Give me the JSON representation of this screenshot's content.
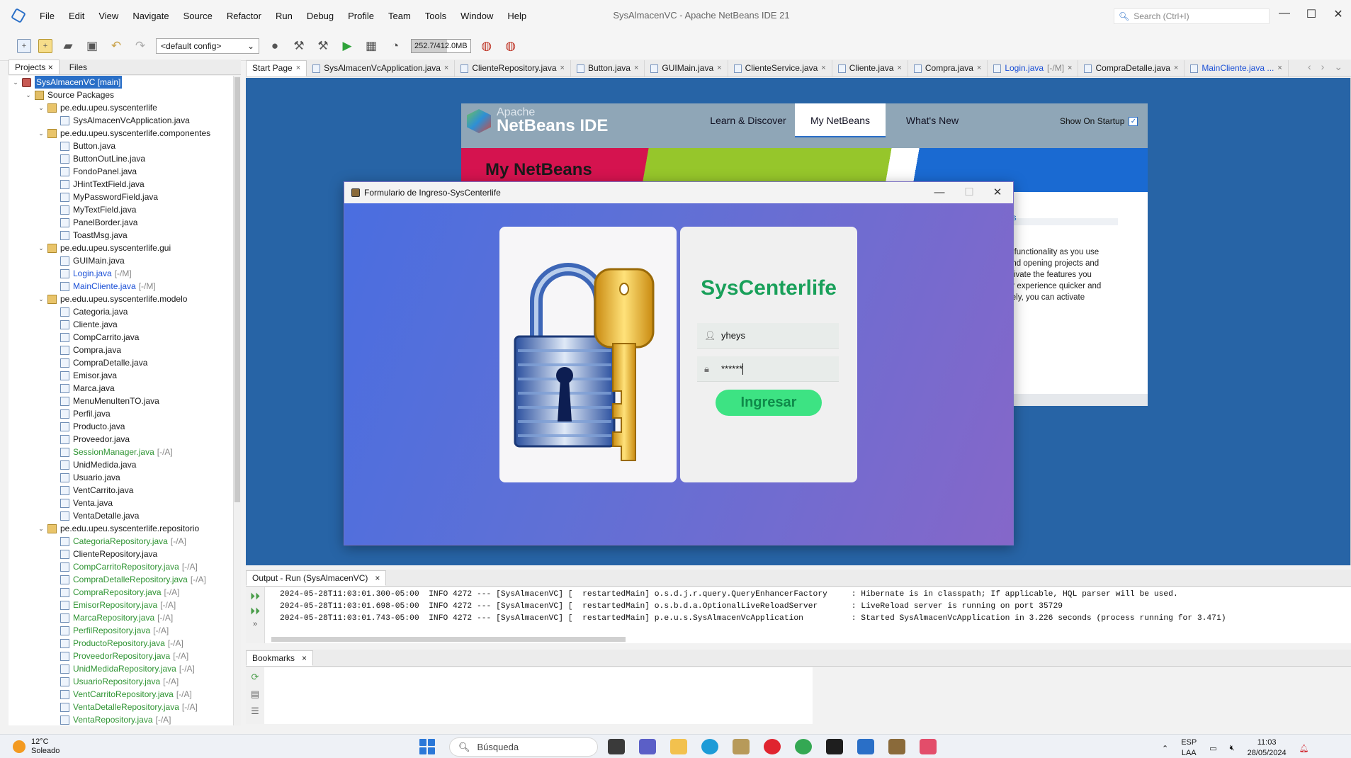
{
  "window": {
    "title": "SysAlmacenVC - Apache NetBeans IDE 21",
    "search_placeholder": "Search (Ctrl+I)",
    "minimize": "—",
    "maximize": "☐",
    "close": "✕"
  },
  "menu": [
    "File",
    "Edit",
    "View",
    "Navigate",
    "Source",
    "Refactor",
    "Run",
    "Debug",
    "Profile",
    "Team",
    "Tools",
    "Window",
    "Help"
  ],
  "toolbar": {
    "config": "<default config>",
    "memory": "252.7/412.0MB"
  },
  "left_panel": {
    "tabs": [
      {
        "label": "Projects",
        "close": "×"
      },
      {
        "label": "Files"
      }
    ],
    "tree": [
      {
        "label": "SysAlmacenVC [main]",
        "depth": 0,
        "type": "proj",
        "toggle": "⌄",
        "selected": true
      },
      {
        "label": "Source Packages",
        "depth": 1,
        "type": "src",
        "toggle": "⌄"
      },
      {
        "label": "pe.edu.upeu.syscenterlife",
        "depth": 2,
        "type": "pkg",
        "toggle": "⌄"
      },
      {
        "label": "SysAlmacenVcApplication.java",
        "depth": 3,
        "type": "file"
      },
      {
        "label": "pe.edu.upeu.syscenterlife.componentes",
        "depth": 2,
        "type": "pkg",
        "toggle": "⌄"
      },
      {
        "label": "Button.java",
        "depth": 3,
        "type": "file"
      },
      {
        "label": "ButtonOutLine.java",
        "depth": 3,
        "type": "file"
      },
      {
        "label": "FondoPanel.java",
        "depth": 3,
        "type": "file"
      },
      {
        "label": "JHintTextField.java",
        "depth": 3,
        "type": "file"
      },
      {
        "label": "MyPasswordField.java",
        "depth": 3,
        "type": "file"
      },
      {
        "label": "MyTextField.java",
        "depth": 3,
        "type": "file"
      },
      {
        "label": "PanelBorder.java",
        "depth": 3,
        "type": "file"
      },
      {
        "label": "ToastMsg.java",
        "depth": 3,
        "type": "file"
      },
      {
        "label": "pe.edu.upeu.syscenterlife.gui",
        "depth": 2,
        "type": "pkg",
        "toggle": "⌄"
      },
      {
        "label": "GUIMain.java",
        "depth": 3,
        "type": "file"
      },
      {
        "label": "Login.java",
        "depth": 3,
        "type": "file",
        "status": "[-/M]",
        "state": "mod"
      },
      {
        "label": "MainCliente.java",
        "depth": 3,
        "type": "file",
        "status": "[-/M]",
        "state": "mod"
      },
      {
        "label": "pe.edu.upeu.syscenterlife.modelo",
        "depth": 2,
        "type": "pkg",
        "toggle": "⌄"
      },
      {
        "label": "Categoria.java",
        "depth": 3,
        "type": "file"
      },
      {
        "label": "Cliente.java",
        "depth": 3,
        "type": "file"
      },
      {
        "label": "CompCarrito.java",
        "depth": 3,
        "type": "file"
      },
      {
        "label": "Compra.java",
        "depth": 3,
        "type": "file"
      },
      {
        "label": "CompraDetalle.java",
        "depth": 3,
        "type": "file"
      },
      {
        "label": "Emisor.java",
        "depth": 3,
        "type": "file"
      },
      {
        "label": "Marca.java",
        "depth": 3,
        "type": "file"
      },
      {
        "label": "MenuMenuItenTO.java",
        "depth": 3,
        "type": "file"
      },
      {
        "label": "Perfil.java",
        "depth": 3,
        "type": "file"
      },
      {
        "label": "Producto.java",
        "depth": 3,
        "type": "file"
      },
      {
        "label": "Proveedor.java",
        "depth": 3,
        "type": "file"
      },
      {
        "label": "SessionManager.java",
        "depth": 3,
        "type": "file",
        "status": "[-/A]",
        "state": "add"
      },
      {
        "label": "UnidMedida.java",
        "depth": 3,
        "type": "file"
      },
      {
        "label": "Usuario.java",
        "depth": 3,
        "type": "file"
      },
      {
        "label": "VentCarrito.java",
        "depth": 3,
        "type": "file"
      },
      {
        "label": "Venta.java",
        "depth": 3,
        "type": "file"
      },
      {
        "label": "VentaDetalle.java",
        "depth": 3,
        "type": "file"
      },
      {
        "label": "pe.edu.upeu.syscenterlife.repositorio",
        "depth": 2,
        "type": "pkg",
        "toggle": "⌄"
      },
      {
        "label": "CategoriaRepository.java",
        "depth": 3,
        "type": "file",
        "status": "[-/A]",
        "state": "add"
      },
      {
        "label": "ClienteRepository.java",
        "depth": 3,
        "type": "file"
      },
      {
        "label": "CompCarritoRepository.java",
        "depth": 3,
        "type": "file",
        "status": "[-/A]",
        "state": "add"
      },
      {
        "label": "CompraDetalleRepository.java",
        "depth": 3,
        "type": "file",
        "status": "[-/A]",
        "state": "add"
      },
      {
        "label": "CompraRepository.java",
        "depth": 3,
        "type": "file",
        "status": "[-/A]",
        "state": "add"
      },
      {
        "label": "EmisorRepository.java",
        "depth": 3,
        "type": "file",
        "status": "[-/A]",
        "state": "add"
      },
      {
        "label": "MarcaRepository.java",
        "depth": 3,
        "type": "file",
        "status": "[-/A]",
        "state": "add"
      },
      {
        "label": "PerfilRepository.java",
        "depth": 3,
        "type": "file",
        "status": "[-/A]",
        "state": "add"
      },
      {
        "label": "ProductoRepository.java",
        "depth": 3,
        "type": "file",
        "status": "[-/A]",
        "state": "add"
      },
      {
        "label": "ProveedorRepository.java",
        "depth": 3,
        "type": "file",
        "status": "[-/A]",
        "state": "add"
      },
      {
        "label": "UnidMedidaRepository.java",
        "depth": 3,
        "type": "file",
        "status": "[-/A]",
        "state": "add"
      },
      {
        "label": "UsuarioRepository.java",
        "depth": 3,
        "type": "file",
        "status": "[-/A]",
        "state": "add"
      },
      {
        "label": "VentCarritoRepository.java",
        "depth": 3,
        "type": "file",
        "status": "[-/A]",
        "state": "add"
      },
      {
        "label": "VentaDetalleRepository.java",
        "depth": 3,
        "type": "file",
        "status": "[-/A]",
        "state": "add"
      },
      {
        "label": "VentaRepository.java",
        "depth": 3,
        "type": "file",
        "status": "[-/A]",
        "state": "add"
      }
    ]
  },
  "editor_tabs": [
    {
      "label": "Start Page",
      "active": true
    },
    {
      "label": "SysAlmacenVcApplication.java"
    },
    {
      "label": "ClienteRepository.java"
    },
    {
      "label": "Button.java"
    },
    {
      "label": "GUIMain.java"
    },
    {
      "label": "ClienteService.java"
    },
    {
      "label": "Cliente.java"
    },
    {
      "label": "Compra.java"
    },
    {
      "label": "Login.java",
      "status": "[-/M]",
      "modified": true
    },
    {
      "label": "CompraDetalle.java"
    },
    {
      "label": "MainCliente.java ...",
      "modified": true
    }
  ],
  "editor_nav": {
    "prev": "‹",
    "next": "›",
    "menu": "⌄"
  },
  "start_page": {
    "logo_small": "Apache",
    "logo_big": "NetBeans IDE",
    "tabs": [
      "Learn & Discover",
      "My NetBeans",
      "What's New"
    ],
    "show_on_startup": "Show On Startup",
    "show_checked": "✓",
    "banner_title": "My NetBeans",
    "link_partial": "es",
    "text_partial": "n functionality as you use\nand opening projects and\nctivate the features you\nur experience quicker and\nvely, you can activate\ny."
  },
  "dialog": {
    "title": "Formulario de Ingreso-SysCenterlife",
    "app_name": "SysCenterlife",
    "username": "yheys",
    "password": "******",
    "login_button": "Ingresar"
  },
  "output": {
    "tab": "Output - Run (SysAlmacenVC)",
    "lines": [
      "2024-05-28T11:03:01.300-05:00  INFO 4272 --- [SysAlmacenVC] [  restartedMain] o.s.d.j.r.query.QueryEnhancerFactory     : Hibernate is in classpath; If applicable, HQL parser will be used.",
      "2024-05-28T11:03:01.698-05:00  INFO 4272 --- [SysAlmacenVC] [  restartedMain] o.s.b.d.a.OptionalLiveReloadServer       : LiveReload server is running on port 35729",
      "2024-05-28T11:03:01.743-05:00  INFO 4272 --- [SysAlmacenVC] [  restartedMain] p.e.u.s.SysAlmacenVcApplication          : Started SysAlmacenVcApplication in 3.226 seconds (process running for 3.471)"
    ]
  },
  "bookmarks": {
    "tab": "Bookmarks"
  },
  "taskbar": {
    "weather_temp": "12°C",
    "weather_desc": "Soleado",
    "search": "Búsqueda",
    "lang1": "ESP",
    "lang2": "LAA",
    "time": "11:03",
    "date": "28/05/2024"
  },
  "colors": {
    "accent": "#2a6fc7",
    "dialog_start": "#4a6ee0",
    "dialog_end": "#8567c9",
    "app_name": "#19a05a",
    "login_button": "#3de383"
  }
}
